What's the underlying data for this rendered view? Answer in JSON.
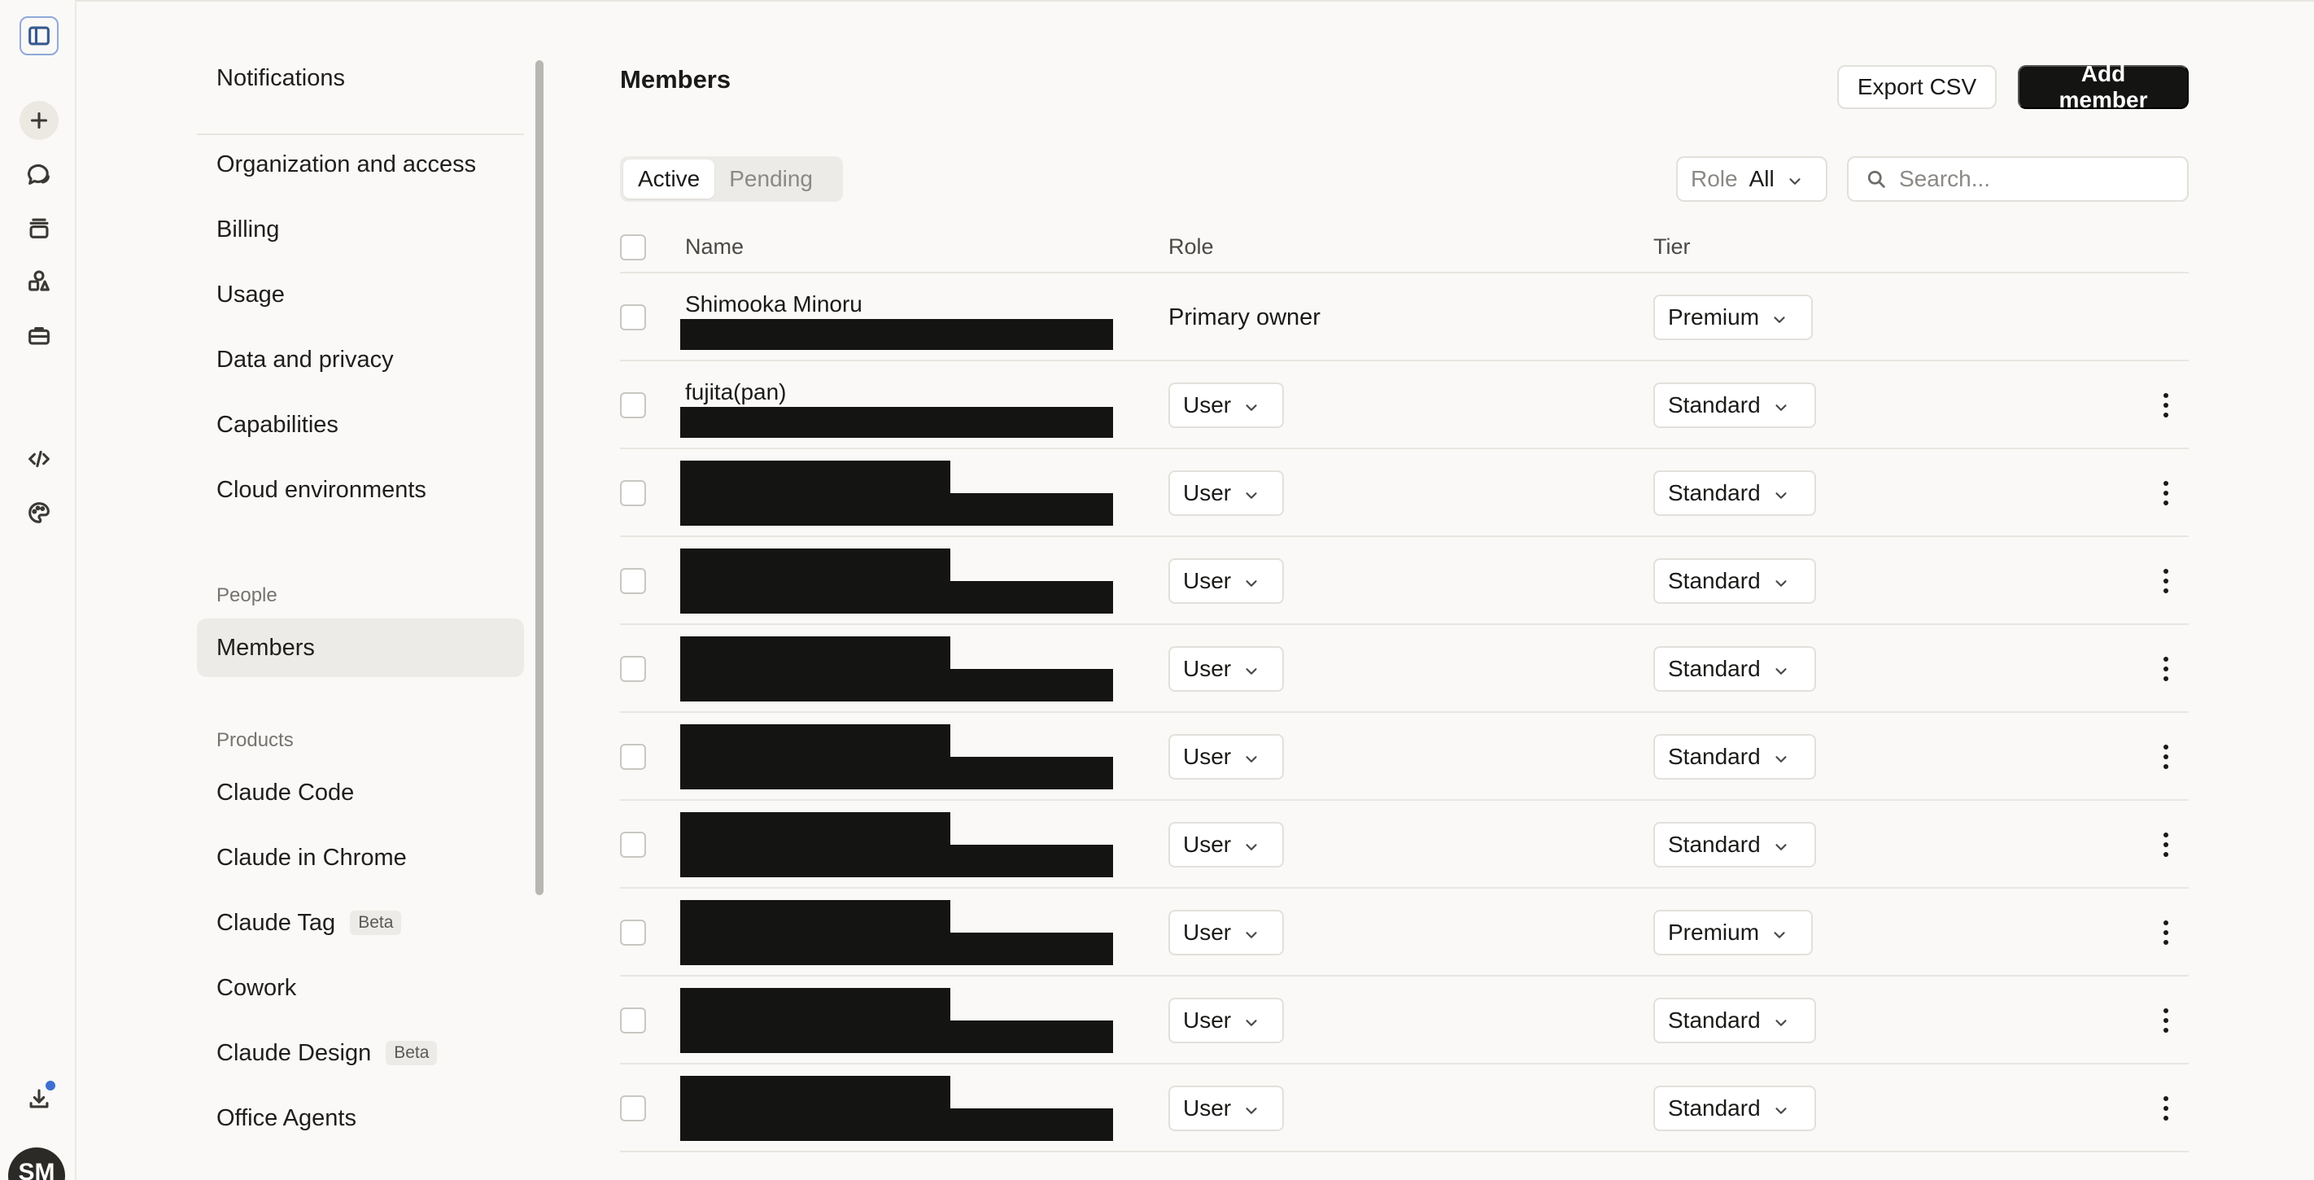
{
  "rail": {
    "icons": [
      "sidebar-toggle-icon",
      "new-chat-icon",
      "chats-icon",
      "projects-icon",
      "artifacts-icon",
      "briefcase-icon",
      "code-icon",
      "palette-icon",
      "download-icon"
    ],
    "avatar_initials": "SM"
  },
  "settings_nav": {
    "top_items": [
      {
        "label": "Notifications"
      },
      {
        "label": "Organization and access"
      },
      {
        "label": "Billing"
      },
      {
        "label": "Usage"
      },
      {
        "label": "Data and privacy"
      },
      {
        "label": "Capabilities"
      },
      {
        "label": "Cloud environments"
      }
    ],
    "people_header": "People",
    "people_items": [
      {
        "label": "Members",
        "active": true
      }
    ],
    "products_header": "Products",
    "product_items": [
      {
        "label": "Claude Code",
        "badge": ""
      },
      {
        "label": "Claude in Chrome",
        "badge": ""
      },
      {
        "label": "Claude Tag",
        "badge": "Beta"
      },
      {
        "label": "Cowork",
        "badge": ""
      },
      {
        "label": "Claude Design",
        "badge": "Beta"
      },
      {
        "label": "Office Agents",
        "badge": ""
      }
    ]
  },
  "main": {
    "title": "Members",
    "export_label": "Export CSV",
    "add_label": "Add member",
    "tabs": [
      {
        "label": "Active",
        "selected": true
      },
      {
        "label": "Pending",
        "selected": false
      }
    ],
    "role_filter": {
      "label": "Role",
      "value": "All"
    },
    "search": {
      "placeholder": "Search..."
    },
    "columns": {
      "name": "Name",
      "role": "Role",
      "tier": "Tier"
    },
    "rows": [
      {
        "name": "Shimooka Minoru",
        "role": "Primary owner",
        "role_editable": false,
        "tier": "Premium",
        "has_menu": false
      },
      {
        "name": "fujita(pan)",
        "role": "User",
        "role_editable": true,
        "tier": "Standard",
        "has_menu": true
      },
      {
        "name": "",
        "role": "User",
        "role_editable": true,
        "tier": "Standard",
        "has_menu": true
      },
      {
        "name": "",
        "role": "User",
        "role_editable": true,
        "tier": "Standard",
        "has_menu": true
      },
      {
        "name": "",
        "role": "User",
        "role_editable": true,
        "tier": "Standard",
        "has_menu": true
      },
      {
        "name": "",
        "role": "User",
        "role_editable": true,
        "tier": "Standard",
        "has_menu": true
      },
      {
        "name": "",
        "role": "User",
        "role_editable": true,
        "tier": "Standard",
        "has_menu": true
      },
      {
        "name": "",
        "role": "User",
        "role_editable": true,
        "tier": "Premium",
        "has_menu": true
      },
      {
        "name": "",
        "role": "User",
        "role_editable": true,
        "tier": "Standard",
        "has_menu": true
      },
      {
        "name": "",
        "role": "User",
        "role_editable": true,
        "tier": "Standard",
        "has_menu": true
      }
    ]
  }
}
